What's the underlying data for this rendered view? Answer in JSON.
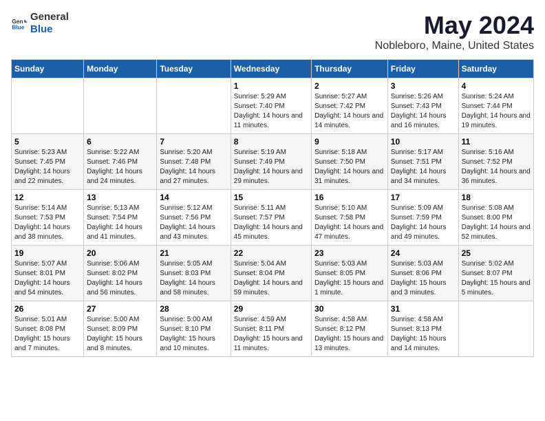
{
  "header": {
    "logo_general": "General",
    "logo_blue": "Blue",
    "title": "May 2024",
    "subtitle": "Nobleboro, Maine, United States"
  },
  "weekdays": [
    "Sunday",
    "Monday",
    "Tuesday",
    "Wednesday",
    "Thursday",
    "Friday",
    "Saturday"
  ],
  "weeks": [
    [
      {
        "day": "",
        "sunrise": "",
        "sunset": "",
        "daylight": ""
      },
      {
        "day": "",
        "sunrise": "",
        "sunset": "",
        "daylight": ""
      },
      {
        "day": "",
        "sunrise": "",
        "sunset": "",
        "daylight": ""
      },
      {
        "day": "1",
        "sunrise": "Sunrise: 5:29 AM",
        "sunset": "Sunset: 7:40 PM",
        "daylight": "Daylight: 14 hours and 11 minutes."
      },
      {
        "day": "2",
        "sunrise": "Sunrise: 5:27 AM",
        "sunset": "Sunset: 7:42 PM",
        "daylight": "Daylight: 14 hours and 14 minutes."
      },
      {
        "day": "3",
        "sunrise": "Sunrise: 5:26 AM",
        "sunset": "Sunset: 7:43 PM",
        "daylight": "Daylight: 14 hours and 16 minutes."
      },
      {
        "day": "4",
        "sunrise": "Sunrise: 5:24 AM",
        "sunset": "Sunset: 7:44 PM",
        "daylight": "Daylight: 14 hours and 19 minutes."
      }
    ],
    [
      {
        "day": "5",
        "sunrise": "Sunrise: 5:23 AM",
        "sunset": "Sunset: 7:45 PM",
        "daylight": "Daylight: 14 hours and 22 minutes."
      },
      {
        "day": "6",
        "sunrise": "Sunrise: 5:22 AM",
        "sunset": "Sunset: 7:46 PM",
        "daylight": "Daylight: 14 hours and 24 minutes."
      },
      {
        "day": "7",
        "sunrise": "Sunrise: 5:20 AM",
        "sunset": "Sunset: 7:48 PM",
        "daylight": "Daylight: 14 hours and 27 minutes."
      },
      {
        "day": "8",
        "sunrise": "Sunrise: 5:19 AM",
        "sunset": "Sunset: 7:49 PM",
        "daylight": "Daylight: 14 hours and 29 minutes."
      },
      {
        "day": "9",
        "sunrise": "Sunrise: 5:18 AM",
        "sunset": "Sunset: 7:50 PM",
        "daylight": "Daylight: 14 hours and 31 minutes."
      },
      {
        "day": "10",
        "sunrise": "Sunrise: 5:17 AM",
        "sunset": "Sunset: 7:51 PM",
        "daylight": "Daylight: 14 hours and 34 minutes."
      },
      {
        "day": "11",
        "sunrise": "Sunrise: 5:16 AM",
        "sunset": "Sunset: 7:52 PM",
        "daylight": "Daylight: 14 hours and 36 minutes."
      }
    ],
    [
      {
        "day": "12",
        "sunrise": "Sunrise: 5:14 AM",
        "sunset": "Sunset: 7:53 PM",
        "daylight": "Daylight: 14 hours and 38 minutes."
      },
      {
        "day": "13",
        "sunrise": "Sunrise: 5:13 AM",
        "sunset": "Sunset: 7:54 PM",
        "daylight": "Daylight: 14 hours and 41 minutes."
      },
      {
        "day": "14",
        "sunrise": "Sunrise: 5:12 AM",
        "sunset": "Sunset: 7:56 PM",
        "daylight": "Daylight: 14 hours and 43 minutes."
      },
      {
        "day": "15",
        "sunrise": "Sunrise: 5:11 AM",
        "sunset": "Sunset: 7:57 PM",
        "daylight": "Daylight: 14 hours and 45 minutes."
      },
      {
        "day": "16",
        "sunrise": "Sunrise: 5:10 AM",
        "sunset": "Sunset: 7:58 PM",
        "daylight": "Daylight: 14 hours and 47 minutes."
      },
      {
        "day": "17",
        "sunrise": "Sunrise: 5:09 AM",
        "sunset": "Sunset: 7:59 PM",
        "daylight": "Daylight: 14 hours and 49 minutes."
      },
      {
        "day": "18",
        "sunrise": "Sunrise: 5:08 AM",
        "sunset": "Sunset: 8:00 PM",
        "daylight": "Daylight: 14 hours and 52 minutes."
      }
    ],
    [
      {
        "day": "19",
        "sunrise": "Sunrise: 5:07 AM",
        "sunset": "Sunset: 8:01 PM",
        "daylight": "Daylight: 14 hours and 54 minutes."
      },
      {
        "day": "20",
        "sunrise": "Sunrise: 5:06 AM",
        "sunset": "Sunset: 8:02 PM",
        "daylight": "Daylight: 14 hours and 56 minutes."
      },
      {
        "day": "21",
        "sunrise": "Sunrise: 5:05 AM",
        "sunset": "Sunset: 8:03 PM",
        "daylight": "Daylight: 14 hours and 58 minutes."
      },
      {
        "day": "22",
        "sunrise": "Sunrise: 5:04 AM",
        "sunset": "Sunset: 8:04 PM",
        "daylight": "Daylight: 14 hours and 59 minutes."
      },
      {
        "day": "23",
        "sunrise": "Sunrise: 5:03 AM",
        "sunset": "Sunset: 8:05 PM",
        "daylight": "Daylight: 15 hours and 1 minute."
      },
      {
        "day": "24",
        "sunrise": "Sunrise: 5:03 AM",
        "sunset": "Sunset: 8:06 PM",
        "daylight": "Daylight: 15 hours and 3 minutes."
      },
      {
        "day": "25",
        "sunrise": "Sunrise: 5:02 AM",
        "sunset": "Sunset: 8:07 PM",
        "daylight": "Daylight: 15 hours and 5 minutes."
      }
    ],
    [
      {
        "day": "26",
        "sunrise": "Sunrise: 5:01 AM",
        "sunset": "Sunset: 8:08 PM",
        "daylight": "Daylight: 15 hours and 7 minutes."
      },
      {
        "day": "27",
        "sunrise": "Sunrise: 5:00 AM",
        "sunset": "Sunset: 8:09 PM",
        "daylight": "Daylight: 15 hours and 8 minutes."
      },
      {
        "day": "28",
        "sunrise": "Sunrise: 5:00 AM",
        "sunset": "Sunset: 8:10 PM",
        "daylight": "Daylight: 15 hours and 10 minutes."
      },
      {
        "day": "29",
        "sunrise": "Sunrise: 4:59 AM",
        "sunset": "Sunset: 8:11 PM",
        "daylight": "Daylight: 15 hours and 11 minutes."
      },
      {
        "day": "30",
        "sunrise": "Sunrise: 4:58 AM",
        "sunset": "Sunset: 8:12 PM",
        "daylight": "Daylight: 15 hours and 13 minutes."
      },
      {
        "day": "31",
        "sunrise": "Sunrise: 4:58 AM",
        "sunset": "Sunset: 8:13 PM",
        "daylight": "Daylight: 15 hours and 14 minutes."
      },
      {
        "day": "",
        "sunrise": "",
        "sunset": "",
        "daylight": ""
      }
    ]
  ]
}
